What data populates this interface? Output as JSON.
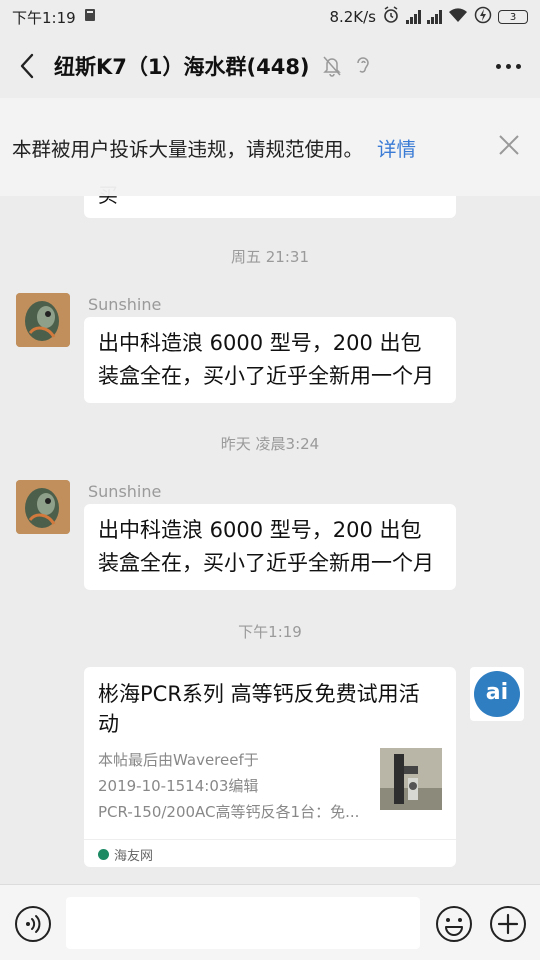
{
  "status_bar": {
    "time": "下午1:19",
    "speed": "8.2K/s",
    "battery": "3"
  },
  "header": {
    "title": "纽斯K7（1）海水群(448)"
  },
  "notice": {
    "text": "本群被用户投诉大量违规，请规范使用。",
    "link": "详情"
  },
  "chat": {
    "partial_message_tail": "买",
    "messages": [
      {
        "timestamp": "周五 21:31",
        "sender": "Sunshine",
        "text": "出中科造浪 6000 型号，200 出包装盒全在，买小了近乎全新用一个月"
      },
      {
        "timestamp": "昨天 凌晨3:24",
        "sender": "Sunshine",
        "text": "出中科造浪 6000 型号，200 出包装盒全在，买小了近乎全新用一个月"
      }
    ],
    "share": {
      "timestamp": "下午1:19",
      "title": "彬海PCR系列 高等钙反免费试用活动",
      "desc_lines": [
        "本帖最后由Wavereef于",
        "2019-10-1514:03编辑",
        "PCR-150/200AC高等钙反各1台：免..."
      ],
      "source": "海友网",
      "avatar_text": "ai"
    }
  },
  "input": {
    "value": ""
  },
  "colors": {
    "link": "#3a7bd5",
    "background": "#ececec",
    "source_dot": "#1d8a64"
  }
}
